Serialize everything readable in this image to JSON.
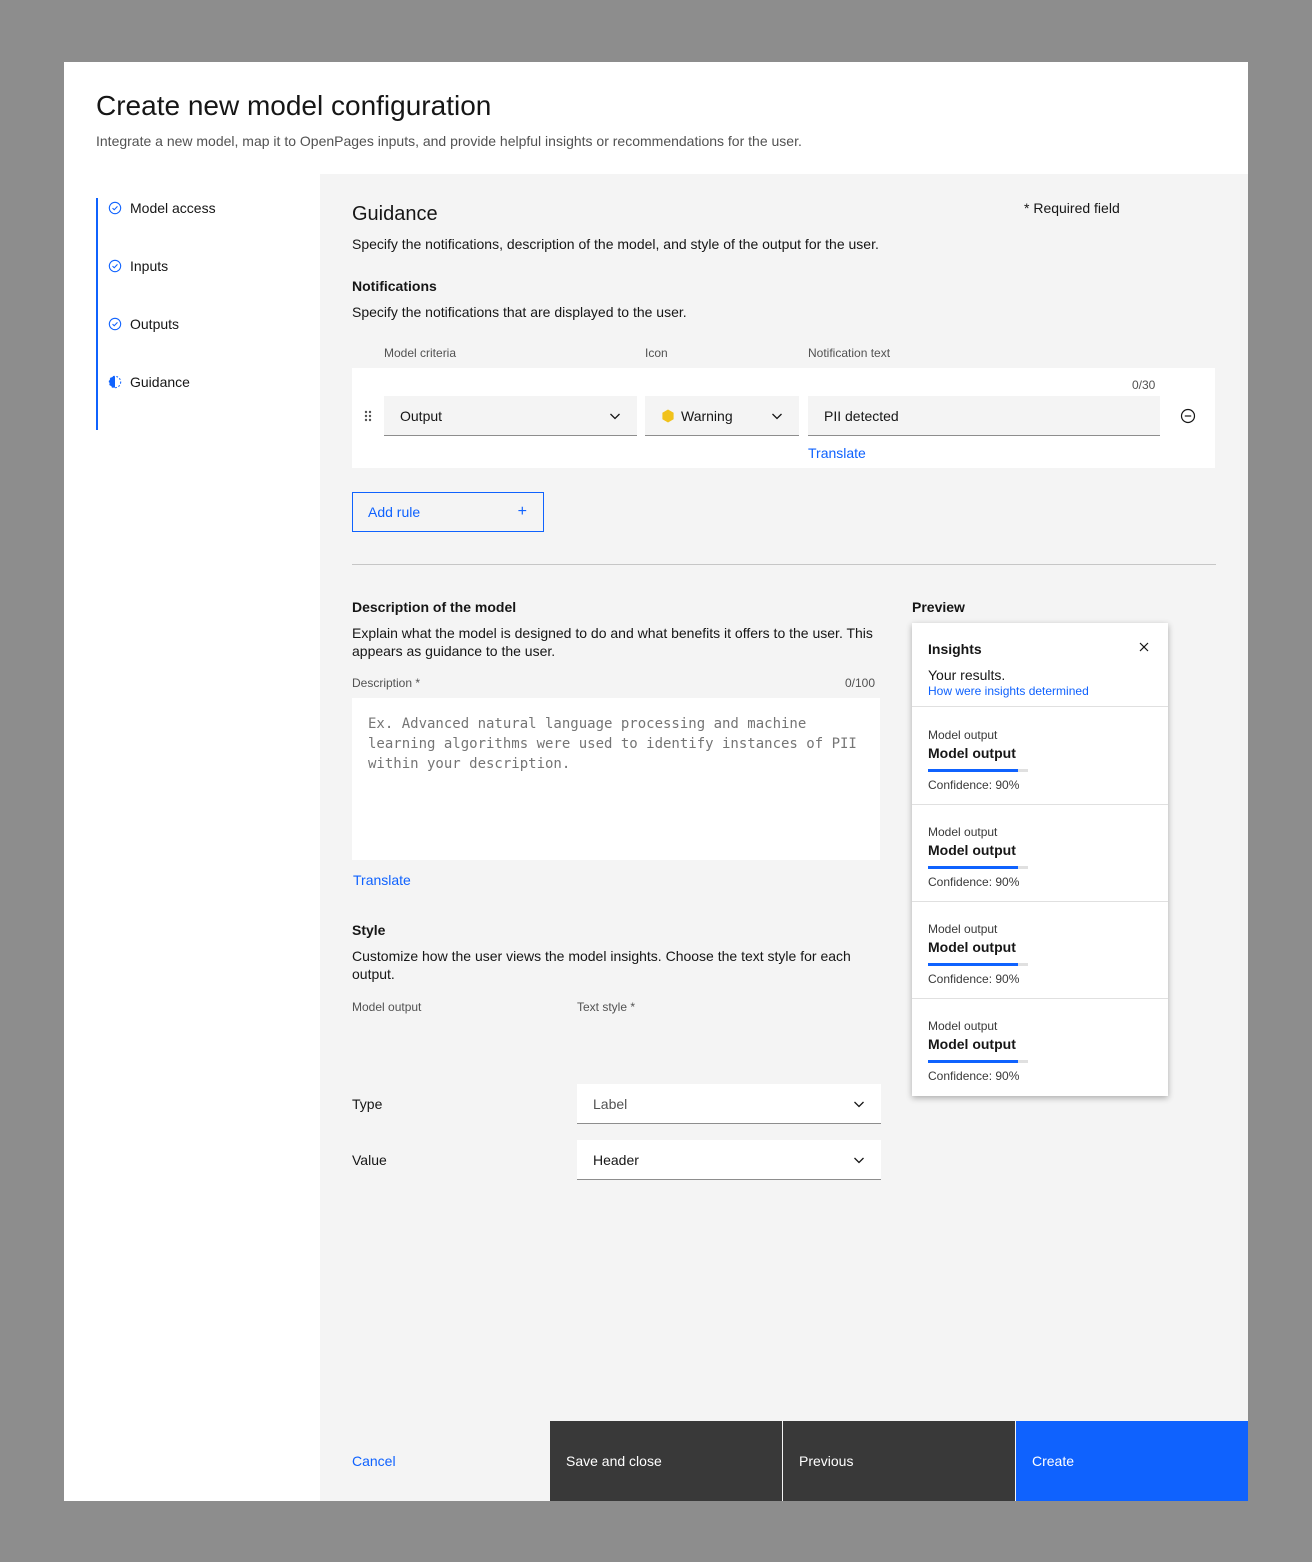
{
  "header": {
    "title": "Create new model configuration",
    "subtitle": "Integrate a new model, map it to OpenPages inputs, and provide helpful insights or recommendations for the user."
  },
  "steps": [
    {
      "label": "Model access",
      "state": "complete"
    },
    {
      "label": "Inputs",
      "state": "complete"
    },
    {
      "label": "Outputs",
      "state": "complete"
    },
    {
      "label": "Guidance",
      "state": "current"
    }
  ],
  "guidance": {
    "title": "Guidance",
    "required_note": "* Required field",
    "description": "Specify the notifications, description of the model, and style of the output for the user."
  },
  "notifications": {
    "heading": "Notifications",
    "description": "Specify the notifications that are displayed to the user.",
    "col_criteria": "Model criteria",
    "col_icon": "Icon",
    "col_text": "Notification text",
    "counter": "0/30",
    "criteria_value": "Output",
    "icon_value": "Warning",
    "text_value": "PII detected",
    "translate": "Translate",
    "add_rule": "Add rule",
    "warning_color": "#f1c21b"
  },
  "description_section": {
    "heading": "Description of the model",
    "text": "Explain what the model is designed to do and what benefits it offers to the user. This appears as guidance to the user.",
    "field_label": "Description *",
    "counter": "0/100",
    "placeholder": "Ex. Advanced natural language processing and machine learning algorithms were used to identify instances of PII within your description.",
    "translate": "Translate"
  },
  "style_section": {
    "heading": "Style",
    "text": "Customize how the user views the model insights. Choose the text style for each output.",
    "col_output": "Model output",
    "col_style": "Text style *",
    "rows": [
      {
        "name": "Type",
        "value": "Label"
      },
      {
        "name": "Value",
        "value": "Header"
      }
    ]
  },
  "preview": {
    "heading": "Preview",
    "title": "Insights",
    "results": "Your results.",
    "link": "How were insights determined",
    "cards": [
      {
        "label": "Model output",
        "value": "Model output",
        "confidence": "Confidence: 90%",
        "level": 0.9
      },
      {
        "label": "Model output",
        "value": "Model output",
        "confidence": "Confidence: 90%",
        "level": 0.9
      },
      {
        "label": "Model output",
        "value": "Model output",
        "confidence": "Confidence: 90%",
        "level": 0.9
      },
      {
        "label": "Model output",
        "value": "Model output",
        "confidence": "Confidence: 90%",
        "level": 0.9
      }
    ]
  },
  "footer": {
    "cancel": "Cancel",
    "save_close": "Save and close",
    "previous": "Previous",
    "create": "Create"
  },
  "colors": {
    "primary": "#0f62fe",
    "dark_button": "#393939"
  }
}
